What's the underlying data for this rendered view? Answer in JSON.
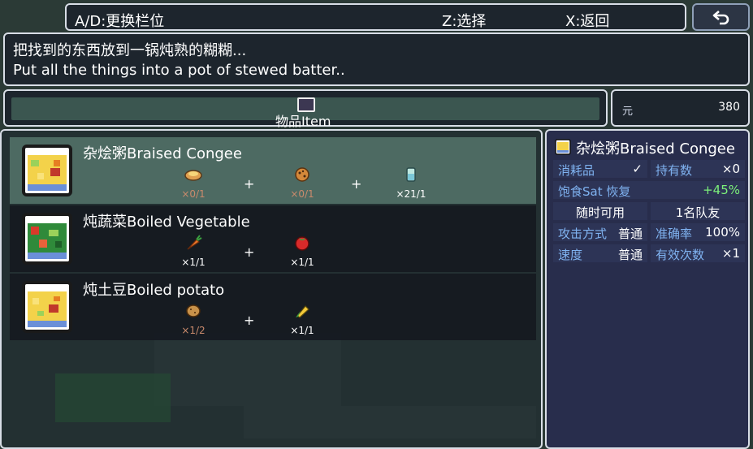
{
  "topbar": {
    "hint_switch": "A/D:更换栏位",
    "hint_select": "Z:选择",
    "hint_back": "X:返回",
    "back_icon": "return-arrow-icon"
  },
  "description": {
    "line_zh": "把找到的东西放到一锅炖熟的糊糊...",
    "line_en": "Put all the things into a pot of stewed batter.."
  },
  "category": {
    "label": "物品Item",
    "icon": "bag-icon"
  },
  "money": {
    "currency": "元",
    "amount": "380"
  },
  "recipes": [
    {
      "name": "杂烩粥Braised Congee",
      "icon": "congee-icon",
      "selected": true,
      "ingredients": [
        {
          "icon": "pie-icon",
          "count": "×0/1",
          "enough": false
        },
        {
          "icon": "cookie-icon",
          "count": "×0/1",
          "enough": false
        },
        {
          "icon": "water-cup-icon",
          "count": "×21/1",
          "enough": true
        }
      ]
    },
    {
      "name": "炖蔬菜Boiled Vegetable",
      "icon": "vegetable-stew-icon",
      "selected": false,
      "ingredients": [
        {
          "icon": "carrot-icon",
          "count": "×1/1",
          "enough": true
        },
        {
          "icon": "tomato-icon",
          "count": "×1/1",
          "enough": true
        }
      ]
    },
    {
      "name": "炖土豆Boiled potato",
      "icon": "potato-stew-icon",
      "selected": false,
      "ingredients": [
        {
          "icon": "potato-icon",
          "count": "×1/2",
          "enough": false
        },
        {
          "icon": "corn-icon",
          "count": "×1/1",
          "enough": true
        }
      ]
    }
  ],
  "detail": {
    "title": "杂烩粥Braised Congee",
    "consumable_label": "消耗品",
    "consumable_value": "✓",
    "owned_label": "持有数",
    "owned_value": "×0",
    "sat_label": "饱食Sat 恢复",
    "sat_value": "+45%",
    "usable": "随时可用",
    "target": "1名队友",
    "attack_label": "攻击方式",
    "attack_value": "普通",
    "accuracy_label": "准确率",
    "accuracy_value": "100%",
    "speed_label": "速度",
    "speed_value": "普通",
    "uses_label": "有效次数",
    "uses_value": "×1"
  },
  "colors": {
    "selected_row": "#4d6a62",
    "key_text": "#7fb2f0",
    "positive_text": "#7cf07a",
    "lacking_text": "#c98a6c"
  }
}
